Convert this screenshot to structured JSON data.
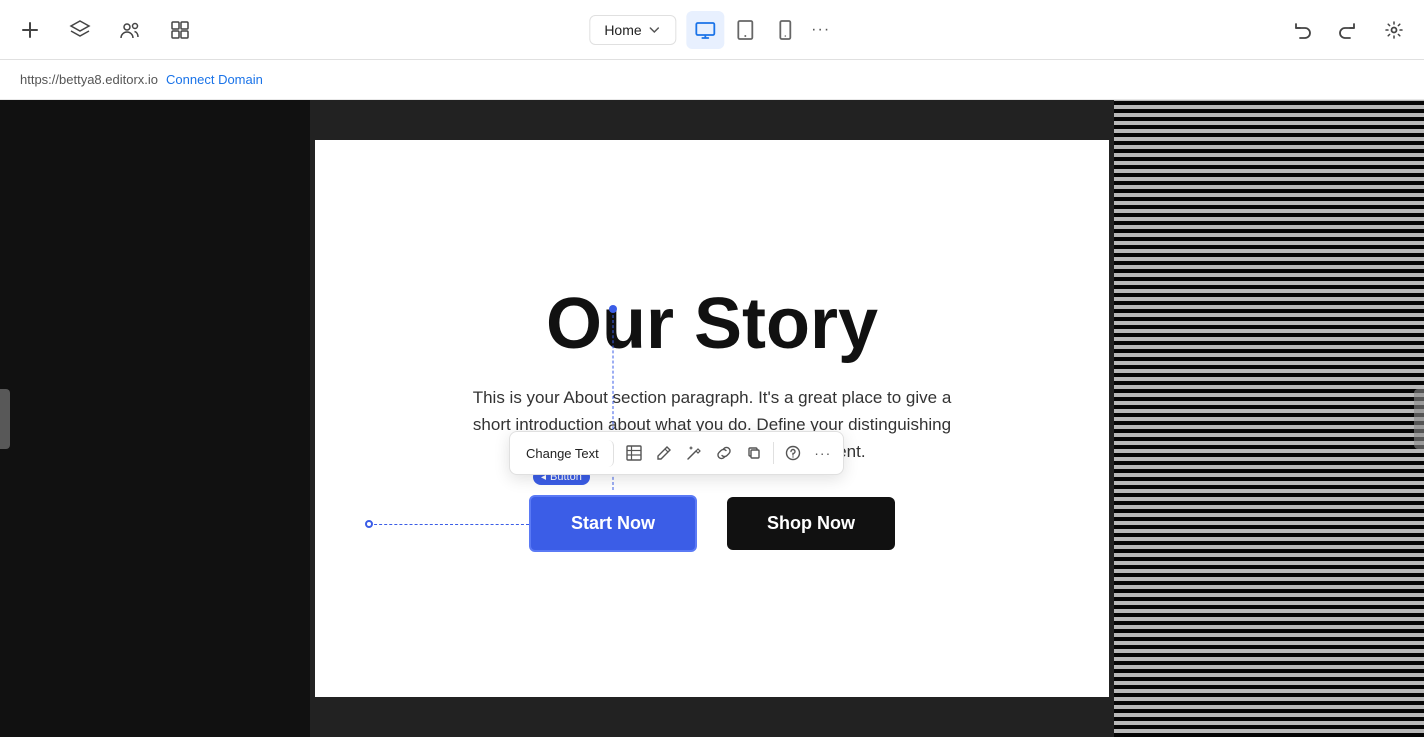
{
  "topbar": {
    "page_selector": "Home",
    "chevron_down": "▾",
    "more_label": "···",
    "undo_title": "Undo",
    "redo_title": "Redo",
    "settings_title": "Settings"
  },
  "address_bar": {
    "url": "https://bettya8.editorx.io",
    "connect_domain": "Connect Domain"
  },
  "canvas": {
    "story_title": "Our Story",
    "story_text": "This is your About section paragraph. It's a great place to give a short introduction about what you do. Define your distinguishing characteristics and ... extra engagement.",
    "start_btn": "Start Now",
    "shop_btn": "Shop Now",
    "button_badge": "Button",
    "toolbar": {
      "change_text": "Change Text",
      "icons": [
        "table-icon",
        "pen-icon",
        "wand-icon",
        "link-icon",
        "copy-icon",
        "help-icon",
        "more-icon"
      ]
    }
  }
}
